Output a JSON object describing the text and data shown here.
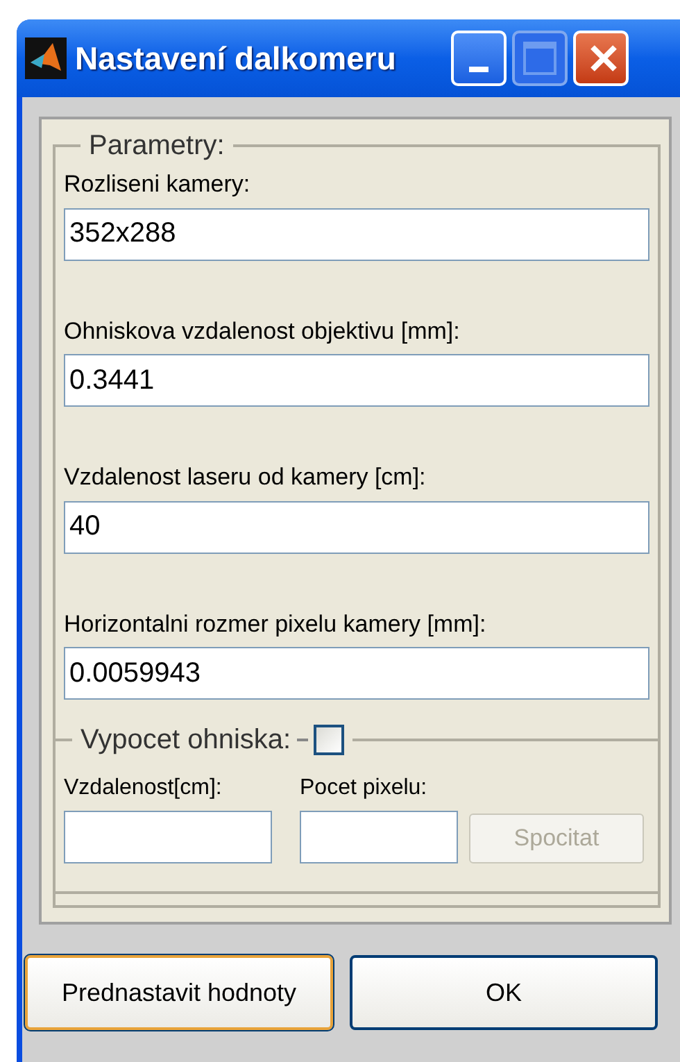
{
  "window": {
    "title": "Nastavení dalkomeru",
    "maximize_disabled": true
  },
  "parameters": {
    "legend": "Parametry:",
    "fields": [
      {
        "label": "Rozliseni kamery:",
        "value": "352x288"
      },
      {
        "label": "Ohniskova vzdalenost objektivu [mm]:",
        "value": "0.3441"
      },
      {
        "label": "Vzdalenost laseru od kamery [cm]:",
        "value": "40"
      },
      {
        "label": "Horizontalni rozmer pixelu kamery [mm]:",
        "value": "0.0059943"
      }
    ]
  },
  "focal": {
    "legend": "Vypocet ohniska:",
    "checked": false,
    "fields": [
      {
        "label": "Vzdalenost[cm]:"
      },
      {
        "label": "Pocet pixelu:"
      }
    ],
    "button": {
      "label": "Spocitat",
      "disabled": true
    }
  },
  "buttons": [
    {
      "label": "Prednastavit hodnoty",
      "focused": true
    },
    {
      "label": "OK",
      "focused": false
    }
  ]
}
